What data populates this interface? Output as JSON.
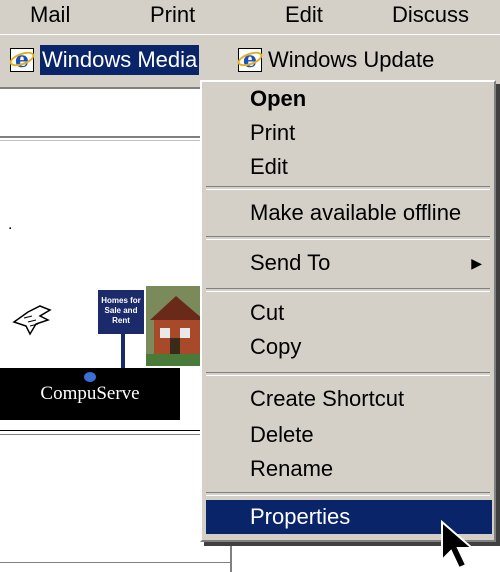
{
  "toolbar": {
    "buttons": [
      {
        "label": "Mail"
      },
      {
        "label": "Print"
      },
      {
        "label": "Edit"
      },
      {
        "label": "Discuss"
      }
    ]
  },
  "links": [
    {
      "label": "Windows Media"
    },
    {
      "label": "Windows Update"
    }
  ],
  "page": {
    "fragment": ".",
    "sign_text": "Homes for Sale and Rent",
    "compuserve_logo": "CompuServe"
  },
  "context_menu": {
    "items": [
      {
        "label": "Open"
      },
      {
        "label": "Print"
      },
      {
        "label": "Edit"
      },
      {
        "label": "Make available offline"
      },
      {
        "label": "Send To"
      },
      {
        "label": "Cut"
      },
      {
        "label": "Copy"
      },
      {
        "label": "Create Shortcut"
      },
      {
        "label": "Delete"
      },
      {
        "label": "Rename"
      },
      {
        "label": "Properties"
      }
    ]
  },
  "colors": {
    "menu_bg": "#d4d0c8",
    "selection": "#0a246a",
    "selection_text": "#ffffff"
  }
}
